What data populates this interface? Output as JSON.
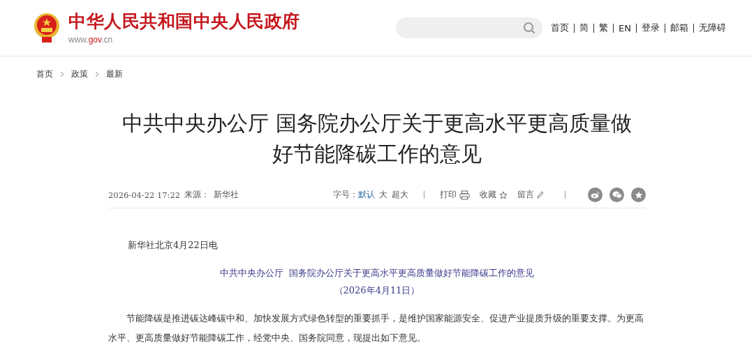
{
  "header": {
    "site_title": "中华人民共和国中央人民政府",
    "url_parts": [
      {
        "text": "www.",
        "highlight": false
      },
      {
        "text": "gov",
        "highlight": true
      },
      {
        "text": ".cn",
        "highlight": false
      }
    ],
    "nav": [
      "首页",
      "简",
      "繁",
      "EN",
      "登录",
      "邮箱",
      "无障碍"
    ]
  },
  "breadcrumb": [
    "首页",
    "政策",
    "最新"
  ],
  "article": {
    "title": "中共中央办公厅 国务院办公厅关于更高水平更高质量做好节能降碳工作的意见",
    "date": "2026-04-22 17:22",
    "source_label": "来源：",
    "source": "新华社",
    "font_label": "字号：",
    "font_sizes": [
      {
        "label": "默认",
        "selected": true
      },
      {
        "label": "大",
        "selected": false
      },
      {
        "label": "超大",
        "selected": false
      }
    ],
    "tools": [
      {
        "label": "打印",
        "kind": "print"
      },
      {
        "label": "收藏",
        "kind": "star"
      },
      {
        "label": "留言",
        "kind": "pencil"
      }
    ],
    "share": [
      {
        "kind": "weibo"
      },
      {
        "kind": "wechat"
      },
      {
        "kind": "favorite"
      }
    ],
    "dateline": "新华社北京4月22日电",
    "doc_title": "中共中央办公厅  国务院办公厅关于更高水平更高质量做好节能降碳工作的意见",
    "doc_date": "（2026年4月11日）",
    "paragraphs": [
      "节能降碳是推进碳达峰碳中和、加快发展方式绿色转型的重要抓手，是维护国家能源安全、促进产业提质升级的重要支撑。为更高水平、更高质量做好节能降碳工作，经党中央、国务院同意，现提出如下意见。"
    ]
  }
}
